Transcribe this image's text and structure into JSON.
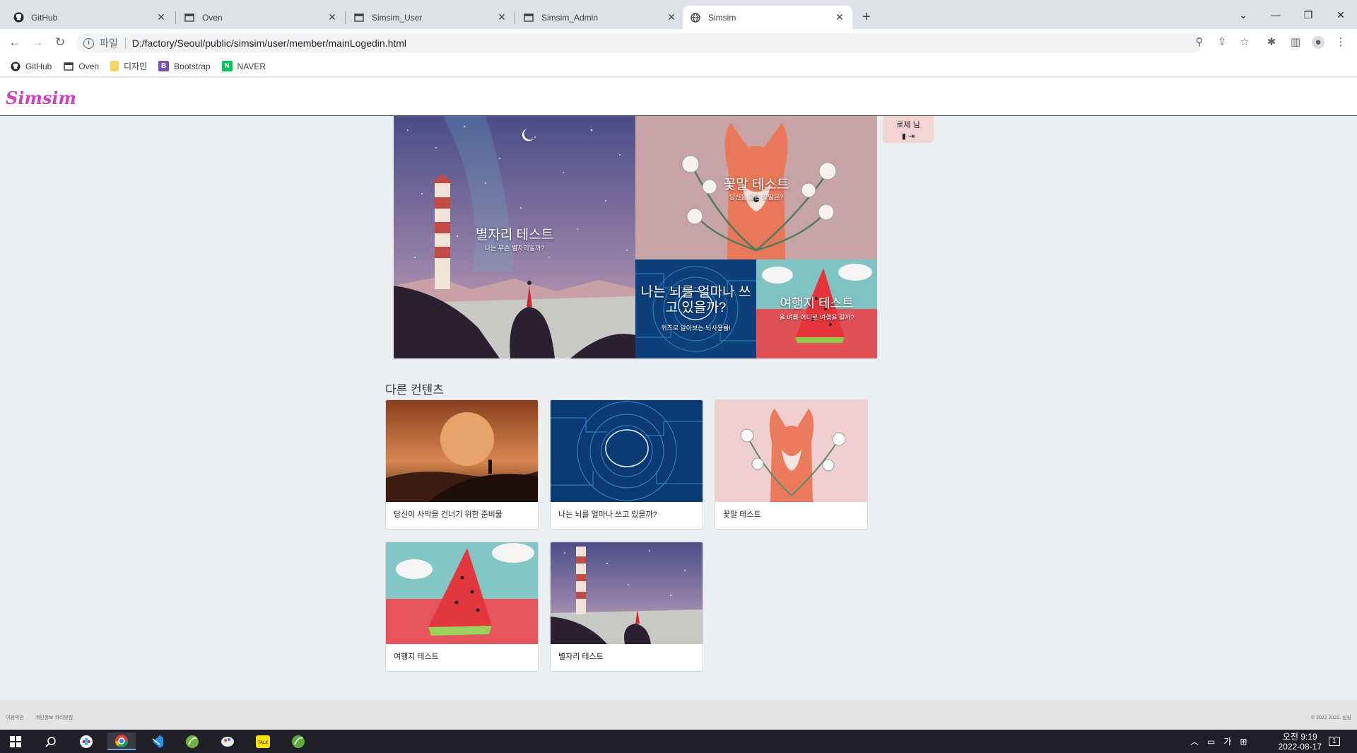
{
  "browser": {
    "tabs": [
      {
        "title": "GitHub",
        "icon": "github-icon"
      },
      {
        "title": "Oven",
        "icon": "window-icon"
      },
      {
        "title": "Simsim_User",
        "icon": "window-icon"
      },
      {
        "title": "Simsim_Admin",
        "icon": "window-icon"
      },
      {
        "title": "Simsim",
        "icon": "globe-icon",
        "active": true
      }
    ],
    "address": {
      "scheme": "파일",
      "url": "D:/factory/Seoul/public/simsim/user/member/mainLogedin.html"
    },
    "bookmarks": [
      {
        "label": "GitHub",
        "icon": "github-icon"
      },
      {
        "label": "Oven",
        "icon": "window-icon"
      },
      {
        "label": "디자인",
        "icon": "folder-icon"
      },
      {
        "label": "Bootstrap",
        "icon": "bootstrap-icon",
        "badge": "B"
      },
      {
        "label": "NAVER",
        "icon": "naver-icon",
        "badge": "N"
      }
    ]
  },
  "site": {
    "logo": "Simsim",
    "user": {
      "name": "로제 님"
    },
    "hero": {
      "star": {
        "title": "별자리 테스트",
        "subtitle": "나는 무슨 별자리일까?"
      },
      "flower": {
        "title": "꽃말 테스트",
        "subtitle": "당신을 닮은 꽃말은?"
      },
      "brain": {
        "title": "나는 뇌를 얼마나 쓰고 있을까?",
        "subtitle": "퀴즈로 알아보는 뇌사용률!"
      },
      "travel": {
        "title": "여행지 테스트",
        "subtitle": "올 여름 어디로 여행을 갈까?"
      }
    },
    "section_title": "다른 컨텐츠",
    "cards": [
      {
        "caption": "당신이 사막을 건너기 위한 준비물"
      },
      {
        "caption": "나는 뇌를 얼마나 쓰고 있을까?"
      },
      {
        "caption": "꽃말 테스트"
      },
      {
        "caption": "여행지 테스트"
      },
      {
        "caption": "별자리 테스트"
      }
    ],
    "footer": {
      "terms": "이용약관",
      "privacy": "개인정보 처리방침",
      "copyright": "© 2022 2022. 심심"
    }
  },
  "taskbar": {
    "ime": "가",
    "time": "오전 9:19",
    "date": "2022-08-17",
    "notifications": "1"
  },
  "colors": {
    "logo": "#d33fc0",
    "page_bg": "#eceff1",
    "userbox": "#f4d3d3"
  }
}
